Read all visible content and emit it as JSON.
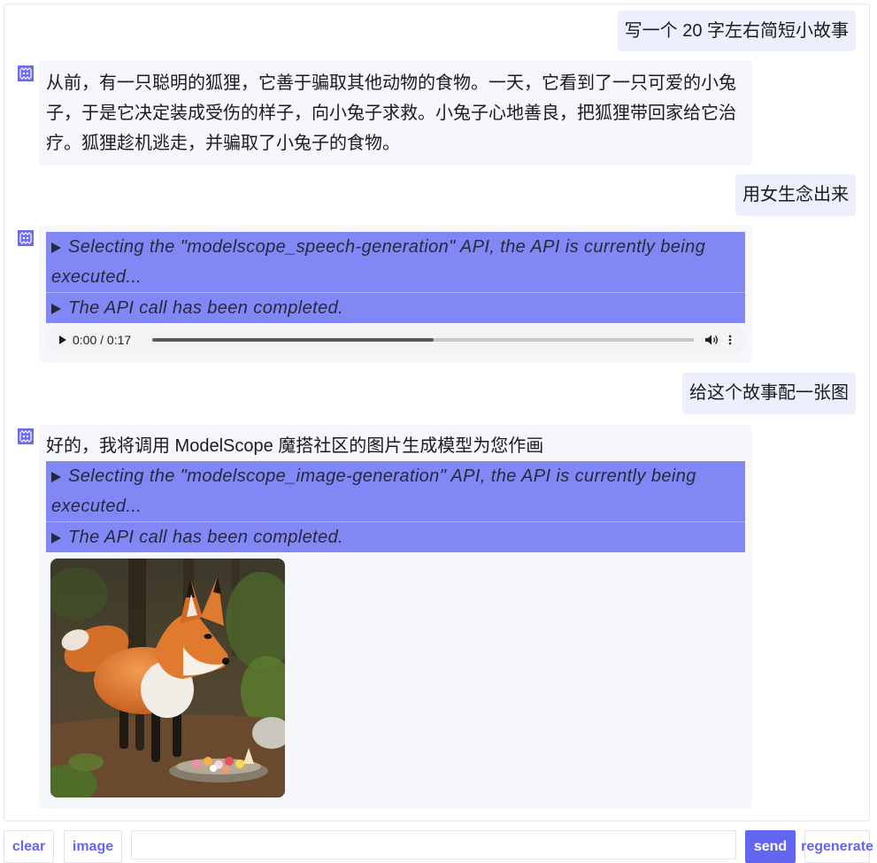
{
  "chat": {
    "messages": [
      {
        "role": "user",
        "text": "写一个 20 字左右简短小故事"
      },
      {
        "role": "assistant",
        "avatar_icon": "bot-avatar-icon",
        "text": "从前，有一只聪明的狐狸，它善于骗取其他动物的食物。一天，它看到了一只可爱的小兔子，于是它决定装成受伤的样子，向小兔子求救。小兔子心地善良，把狐狸带回家给它治疗。狐狸趁机逃走，并骗取了小兔子的食物。"
      },
      {
        "role": "user",
        "text": "用女生念出来"
      },
      {
        "role": "assistant",
        "avatar_icon": "bot-avatar-icon",
        "tool_steps": [
          {
            "icon": "disclosure-triangle-icon",
            "text": "Selecting the \"modelscope_speech-generation\" API, the API is currently being executed..."
          },
          {
            "icon": "disclosure-triangle-icon",
            "text": "The API call has been completed."
          }
        ],
        "audio": {
          "time_label": "0:00 / 0:17",
          "buffered_fraction": 0.52,
          "play_icon": "play-icon",
          "volume_icon": "volume-icon",
          "menu_icon": "more-options-icon"
        }
      },
      {
        "role": "user",
        "text": "给这个故事配一张图"
      },
      {
        "role": "assistant",
        "avatar_icon": "bot-avatar-icon",
        "text": "好的，我将调用 ModelScope 魔搭社区的图片生成模型为您作画",
        "tool_steps": [
          {
            "icon": "disclosure-triangle-icon",
            "text": "Selecting the \"modelscope_image-generation\" API, the API is currently being executed..."
          },
          {
            "icon": "disclosure-triangle-icon",
            "text": "The API call has been completed."
          }
        ]
      }
    ]
  },
  "input_bar": {
    "clear_label": "clear",
    "image_label": "image",
    "message_value": "",
    "send_label": "send",
    "regenerate_label": "regenerate"
  },
  "colors": {
    "accent": "#6366f1",
    "tool_block": "#8187f5",
    "user_bubble": "#edf0fc",
    "bot_bubble": "#f6f7fb"
  }
}
